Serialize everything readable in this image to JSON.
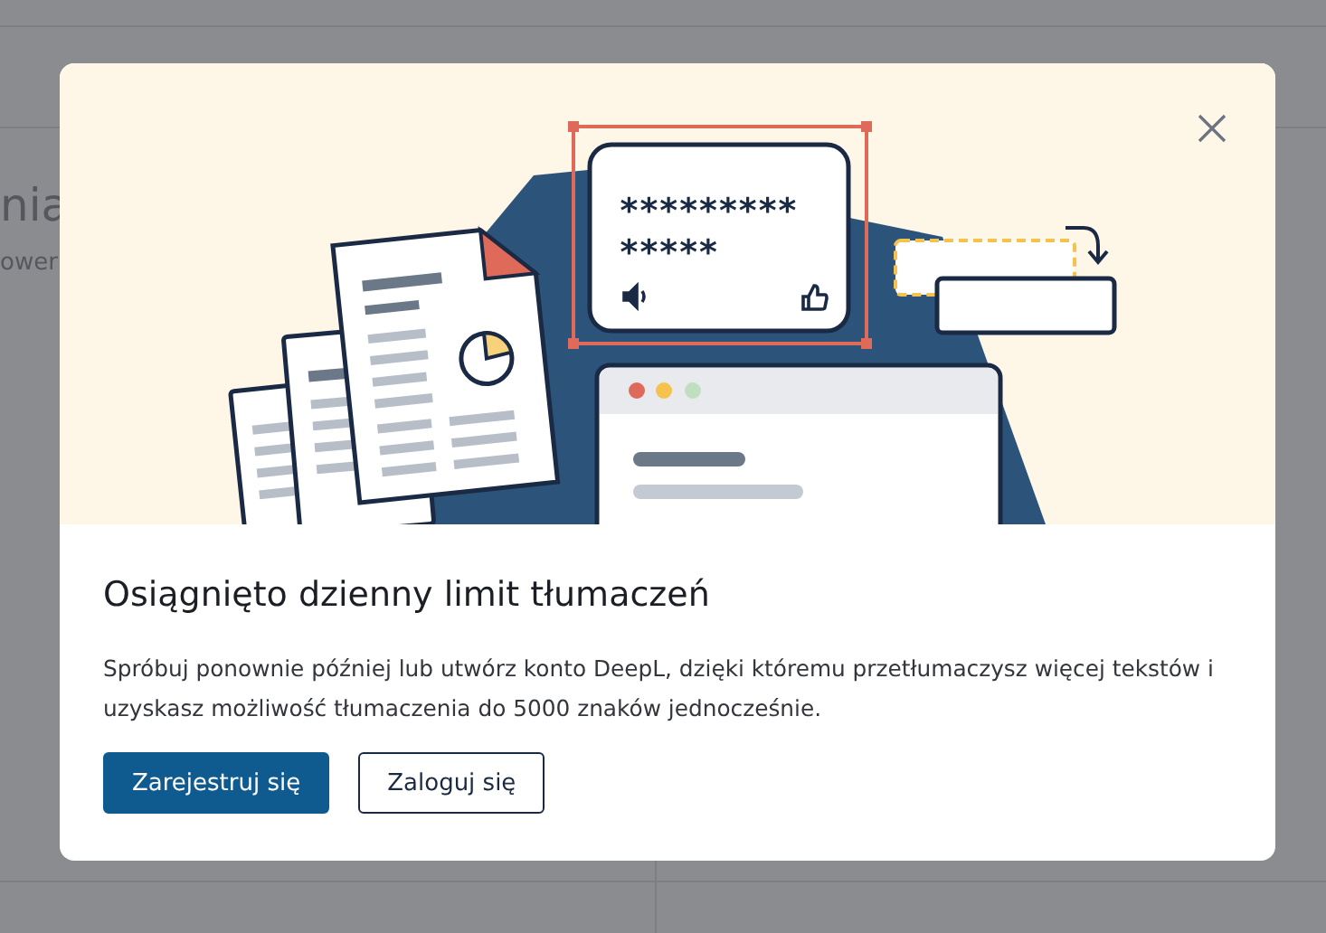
{
  "background": {
    "heading_fragment": "nia",
    "subtitle_fragment": "ower"
  },
  "dialog": {
    "illustration": {
      "masked_lines": [
        "*********",
        "*****"
      ]
    },
    "title": "Osiągnięto dzienny limit tłumaczeń",
    "message": "Spróbuj ponownie później lub utwórz konto DeepL, dzięki któremu przetłumaczysz więcej tekstów i uzyskasz możliwość tłumaczenia do 5000 znaków jednocześnie.",
    "buttons": [
      {
        "label": "Zarejestruj się",
        "kind": "primary"
      },
      {
        "label": "Zaloguj się",
        "kind": "secondary"
      }
    ]
  }
}
